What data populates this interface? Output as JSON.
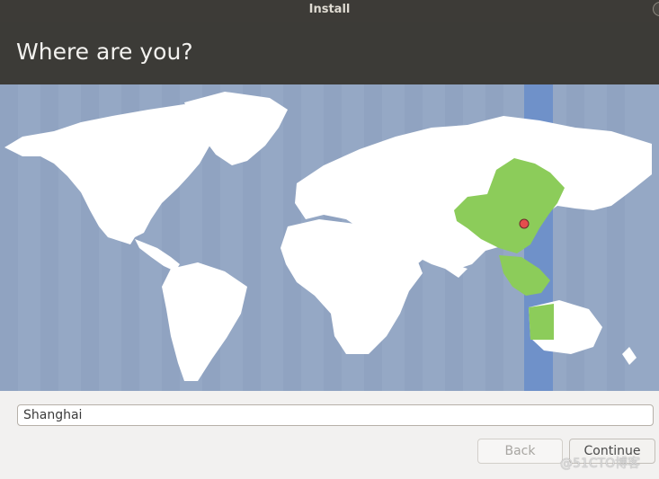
{
  "window": {
    "title": "Install"
  },
  "header": {
    "title": "Where are you?"
  },
  "map": {
    "selected_region": "China / Asia-Shanghai",
    "colors": {
      "ocean": "#95a8c5",
      "land": "#ffffff",
      "selected_timezone_band": "#6f91c9",
      "highlight_land": "#8ccc5a",
      "pin": "#e44d4d"
    }
  },
  "location_input": {
    "value": "Shanghai"
  },
  "buttons": {
    "back": "Back",
    "continue": "Continue"
  },
  "watermark": "@51CTO博客"
}
